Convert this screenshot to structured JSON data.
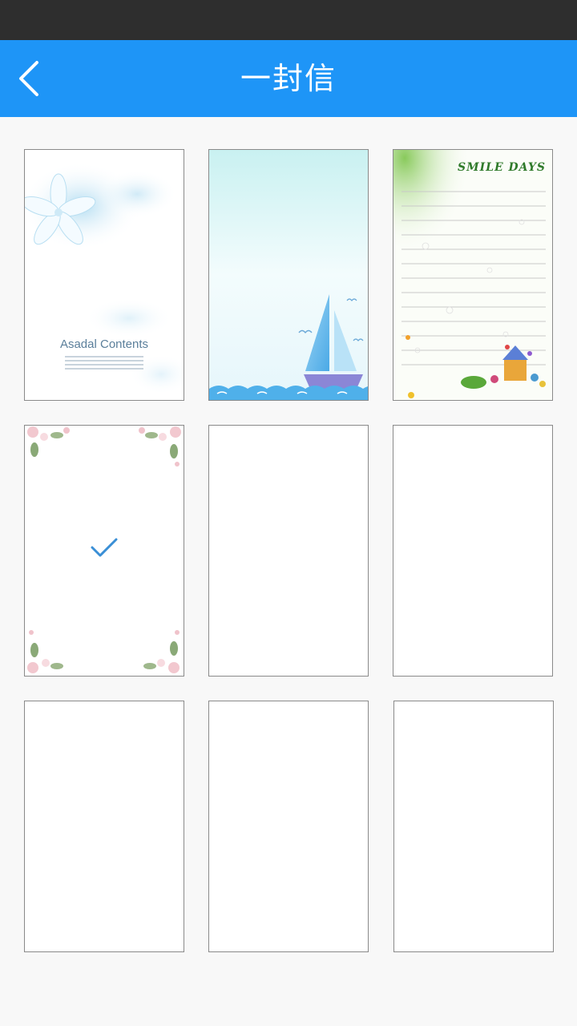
{
  "header": {
    "title": "一封信",
    "back_icon": "chevron-left-icon"
  },
  "colors": {
    "status_bar": "#2e2e2e",
    "nav_bar": "#1e95f7",
    "background": "#f8f8f8",
    "check": "#3a8fd6"
  },
  "templates": [
    {
      "id": 1,
      "style": "blue-flower",
      "text": "Asadal Contents",
      "selected": false
    },
    {
      "id": 2,
      "style": "sailboat",
      "selected": false
    },
    {
      "id": 3,
      "style": "smile-days",
      "text": "SMILE DAYS",
      "selected": false
    },
    {
      "id": 4,
      "style": "floral-corners",
      "selected": true
    },
    {
      "id": 5,
      "style": "blank",
      "selected": false
    },
    {
      "id": 6,
      "style": "blank",
      "selected": false
    },
    {
      "id": 7,
      "style": "blank",
      "selected": false
    },
    {
      "id": 8,
      "style": "blank",
      "selected": false
    },
    {
      "id": 9,
      "style": "blank",
      "selected": false
    }
  ]
}
